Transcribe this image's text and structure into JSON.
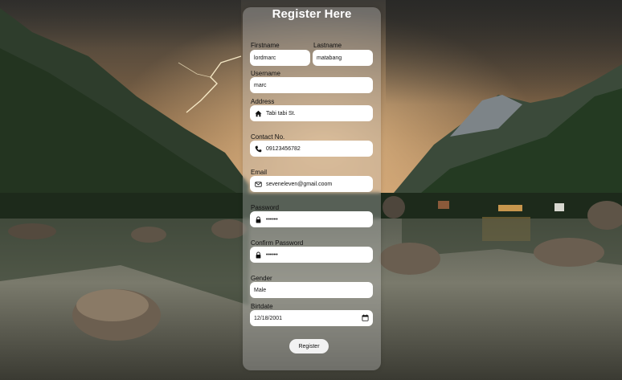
{
  "form": {
    "title": "Register Here",
    "firstname": {
      "label": "Firstname",
      "value": "lordmarc"
    },
    "lastname": {
      "label": "Lastname",
      "value": "matabang"
    },
    "username": {
      "label": "Username",
      "value": "marc"
    },
    "address": {
      "label": "Address",
      "value": "Tabi tabi St.",
      "icon": "home-icon"
    },
    "contact": {
      "label": "Contact No.",
      "value": "09123456782",
      "icon": "phone-icon"
    },
    "email": {
      "label": "Email",
      "value": "seveneleven@gmail.coom",
      "icon": "envelope-icon"
    },
    "password": {
      "label": "Password",
      "value": "••••••",
      "icon": "lock-icon"
    },
    "confirm_password": {
      "label": "Confirm Password",
      "value": "••••••",
      "icon": "lock-icon"
    },
    "gender": {
      "label": "Gender",
      "value": "Male"
    },
    "birthdate": {
      "label": "Birtdate",
      "value": "12/18/2001",
      "icon": "calendar-icon"
    },
    "submit_label": "Register"
  },
  "colors": {
    "card_bg": "rgba(210,210,210,0.32)",
    "title_text": "#ffffff",
    "input_bg": "#ffffff",
    "button_bg": "#f2f2f2"
  }
}
